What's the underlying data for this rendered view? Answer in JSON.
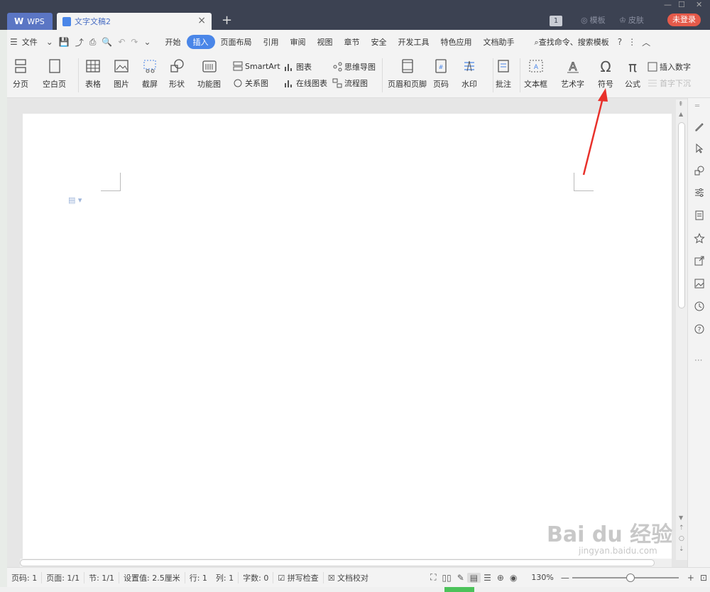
{
  "titlebar": {
    "wps_label": "WPS",
    "doc_tab": "文字文稿2",
    "badge": "1",
    "template": "模板",
    "skin": "皮肤",
    "login": "未登录"
  },
  "menu": {
    "file": "文件",
    "items": [
      "开始",
      "插入",
      "页面布局",
      "引用",
      "审阅",
      "视图",
      "章节",
      "安全",
      "开发工具",
      "特色应用",
      "文档助手"
    ],
    "active": "插入",
    "search": "查找命令、搜索模板"
  },
  "ribbon": {
    "page_break": "分页",
    "blank_page": "空白页",
    "table": "表格",
    "picture": "图片",
    "screenshot": "截屏",
    "shape": "形状",
    "function_chart": "功能图",
    "smartart": "SmartArt",
    "relation": "关系图",
    "chart": "图表",
    "online_chart": "在线图表",
    "mindmap": "思维导图",
    "flowchart": "流程图",
    "header_footer": "页眉和页脚",
    "page_num": "页码",
    "watermark": "水印",
    "comment": "批注",
    "textbox": "文本框",
    "wordart": "艺术字",
    "symbol": "符号",
    "formula": "公式",
    "insert_num": "插入数字",
    "first_drop": "首字下沉"
  },
  "status": {
    "page": "页码: 1",
    "pages": "页面: 1/1",
    "section": "节: 1/1",
    "setting": "设置值: 2.5厘米",
    "row": "行: 1",
    "col": "列: 1",
    "words": "字数: 0",
    "spell": "拼写检查",
    "proof": "文档校对",
    "zoom": "130%"
  },
  "watermark": {
    "main": "Bai du 经验",
    "sub": "jingyan.baidu.com"
  },
  "colors": {
    "accent": "#4a86e8",
    "titlebar": "#3c4252",
    "login": "#e55a4a",
    "arrow": "#e8302a"
  }
}
